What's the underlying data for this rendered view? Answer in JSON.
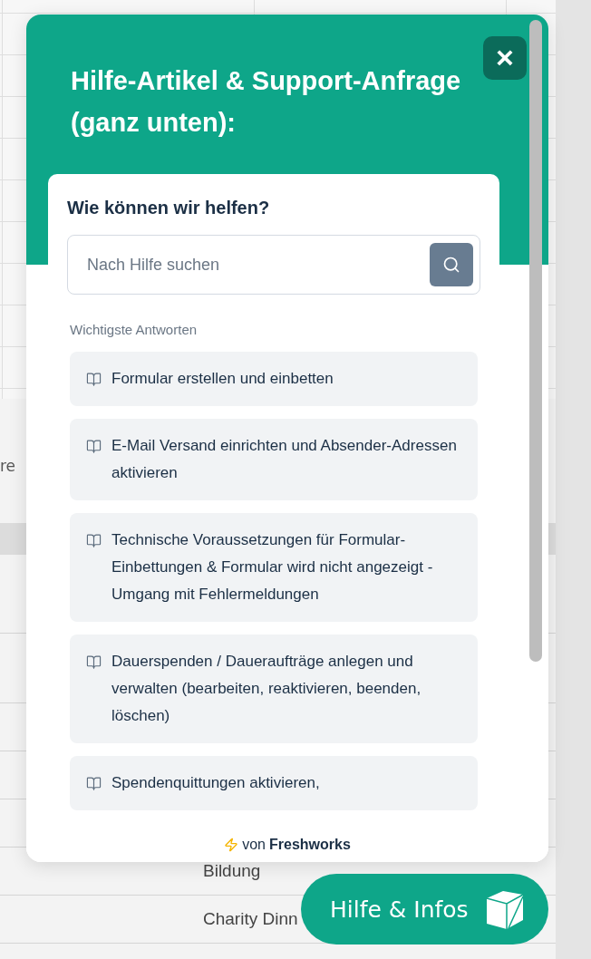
{
  "background_page": {
    "side_text": "re",
    "rows": [
      "Bildung",
      "Charity Dinn"
    ]
  },
  "widget": {
    "title": "Hilfe-Artikel & Support-Anfrage (ganz unten):",
    "close_button": {
      "label": "×"
    },
    "card": {
      "heading": "Wie können wir helfen?",
      "search": {
        "placeholder": "Nach Hilfe suchen"
      },
      "section_title": "Wichtigste Antworten",
      "articles": [
        {
          "title": "Formular erstellen und einbetten"
        },
        {
          "title": "E-Mail Versand einrichten und Absender-Adressen aktivieren"
        },
        {
          "title": "Technische Voraussetzungen für Formular-Einbettungen & Formular wird nicht angezeigt - Umgang mit Fehlermeldungen"
        },
        {
          "title": "Dauerspenden / Daueraufträge anlegen und verwalten (bearbeiten, reaktivieren, beenden, löschen)"
        },
        {
          "title": "Spendenquittungen aktivieren,"
        }
      ]
    },
    "footer": {
      "prefix": "von",
      "brand": "Freshworks"
    }
  },
  "launcher": {
    "label": "Hilfe & Infos"
  }
}
